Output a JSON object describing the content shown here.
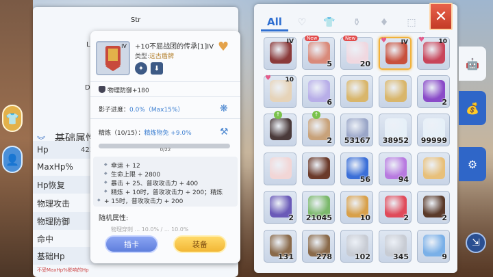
{
  "stats_panel": {
    "radar_labels": [
      "Str",
      "Lu",
      "De"
    ],
    "section_title": "基础属性",
    "rows": [
      {
        "label": "Hp",
        "value": "42333"
      },
      {
        "label": "MaxHp%",
        "value": ""
      },
      {
        "label": "Hp恢复",
        "value": ""
      },
      {
        "label": "物理攻击",
        "value": ""
      },
      {
        "label": "物理防御",
        "value": ""
      },
      {
        "label": "命中",
        "value": ""
      },
      {
        "label": "基础Hp",
        "value": ""
      }
    ],
    "note": "不受MaxHp%影响的Hp"
  },
  "item_detail": {
    "tier": "IV",
    "title": "+10不屈战团的传承[1]IV",
    "type_label": "类型:",
    "type_value": "远古盾牌",
    "main_attr": "物理防御+180",
    "shadow_progress_label": "影子进度：",
    "shadow_progress_value": "0.0%（Max15%）",
    "refine_label": "精炼（10/15）：",
    "refine_value": "精炼物免 +9.0%",
    "refine_bar_text": "0/22",
    "refine_bar_fraction": 0.0,
    "card_effects": [
      "幸运 + 12",
      "生命上限 + 2800",
      "暴击 + 25、普攻攻击力 + 400",
      "精炼 + 10时，普攻攻击力 + 200；精炼",
      "+ 15时，普攻攻击力 + 200"
    ],
    "random_attr_title": "随机属性:",
    "random_attr_line": "物理穿刺 ... 10.0% / ... 10.0%",
    "btn_card": "插卡",
    "btn_equip": "装备"
  },
  "inventory": {
    "filters": [
      "All",
      "♡",
      "👕",
      "⚱",
      "♦",
      "⬚"
    ],
    "active_filter": 0,
    "close_label": "✕",
    "slots": [
      {
        "color": "#8b3a3a",
        "tier": "IV",
        "count": "",
        "new": false,
        "heart": false
      },
      {
        "color": "#d98a7a",
        "tier": "",
        "count": "5",
        "new": true,
        "heart": false
      },
      {
        "color": "#f0d8e0",
        "tier": "",
        "count": "20",
        "new": true,
        "heart": false
      },
      {
        "color": "#c8503c",
        "tier": "IV",
        "count": "",
        "new": false,
        "heart": true,
        "selected": true
      },
      {
        "color": "#c8455a",
        "tier": "10",
        "count": "",
        "new": false,
        "heart": true
      },
      {
        "color": "#e6d3b8",
        "tier": "10",
        "count": "",
        "new": false,
        "heart": true
      },
      {
        "color": "#b8aee8",
        "tier": "",
        "count": "6",
        "new": false,
        "heart": false
      },
      {
        "color": "#d9b66b",
        "tier": "",
        "count": "",
        "new": false,
        "heart": false
      },
      {
        "color": "#d9b66b",
        "tier": "",
        "count": "",
        "new": false,
        "heart": false
      },
      {
        "color": "#8a4bc8",
        "tier": "",
        "count": "2",
        "new": false,
        "heart": false
      },
      {
        "color": "#4a3a3a",
        "tier": "",
        "count": "",
        "new": false,
        "heart": false,
        "up": true
      },
      {
        "color": "#c8a27a",
        "tier": "",
        "count": "2",
        "new": false,
        "heart": false,
        "up": true
      },
      {
        "color": "#9aa6c8",
        "tier": "",
        "count": "53167",
        "new": false,
        "heart": false
      },
      {
        "color": "#e6f0f8",
        "tier": "",
        "count": "38952",
        "new": false,
        "heart": false
      },
      {
        "color": "#e6f0f8",
        "tier": "",
        "count": "99999",
        "new": false,
        "heart": false
      },
      {
        "color": "#f2d6d6",
        "tier": "",
        "count": "",
        "new": false,
        "heart": false
      },
      {
        "color": "#6b3a2a",
        "tier": "",
        "count": "",
        "new": false,
        "heart": false
      },
      {
        "color": "#3b6fd8",
        "tier": "",
        "count": "56",
        "new": false,
        "heart": false
      },
      {
        "color": "#b87ae0",
        "tier": "",
        "count": "94",
        "new": false,
        "heart": false
      },
      {
        "color": "#e8c07a",
        "tier": "",
        "count": "",
        "new": false,
        "heart": false
      },
      {
        "color": "#6a5ab8",
        "tier": "",
        "count": "2",
        "new": false,
        "heart": false
      },
      {
        "color": "#7ab86a",
        "tier": "",
        "count": "21045",
        "new": false,
        "heart": false
      },
      {
        "color": "#d8a04a",
        "tier": "",
        "count": "10",
        "new": false,
        "heart": false
      },
      {
        "color": "#e04a5a",
        "tier": "",
        "count": "2",
        "new": false,
        "heart": false
      },
      {
        "color": "#5a3a2a",
        "tier": "",
        "count": "2",
        "new": false,
        "heart": false
      },
      {
        "color": "#8a6a4a",
        "tier": "",
        "count": "131",
        "new": false,
        "heart": false
      },
      {
        "color": "#8a6a4a",
        "tier": "",
        "count": "278",
        "new": false,
        "heart": false
      },
      {
        "color": "#c8ccd4",
        "tier": "",
        "count": "102",
        "new": false,
        "heart": false
      },
      {
        "color": "#c8ccd4",
        "tier": "",
        "count": "345",
        "new": false,
        "heart": false
      },
      {
        "color": "#7ab0e8",
        "tier": "",
        "count": "9",
        "new": false,
        "heart": false
      }
    ]
  },
  "side_tabs": {
    "right": [
      "robot-icon",
      "bag-icon",
      "gear-icon"
    ],
    "left": [
      "shirt-icon",
      "person-icon"
    ]
  }
}
